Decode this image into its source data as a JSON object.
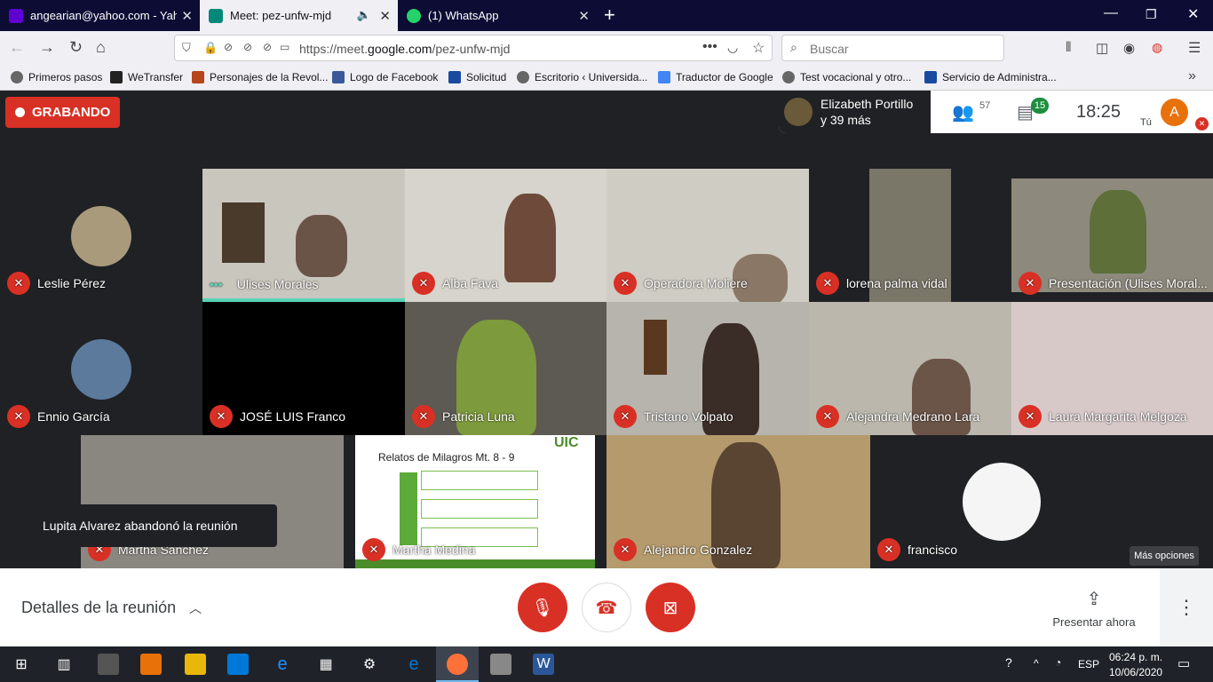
{
  "browser": {
    "tabs": [
      {
        "label": "angearian@yahoo.com - Yahoo",
        "color": "#6001d2"
      },
      {
        "label": "Meet: pez-unfw-mjd",
        "color": "#00897b"
      },
      {
        "label": "(1) WhatsApp",
        "color": "#25d366"
      }
    ],
    "url_prefix": "https://meet.",
    "url_domain": "google.com",
    "url_path": "/pez-unfw-mjd",
    "search_placeholder": "Buscar"
  },
  "bookmarks": [
    {
      "label": "Primeros pasos",
      "color": "#666"
    },
    {
      "label": "WeTransfer",
      "color": "#222"
    },
    {
      "label": "Personajes de la Revol...",
      "color": "#b5451b"
    },
    {
      "label": "Logo de Facebook",
      "color": "#3b5998"
    },
    {
      "label": "Solicitud",
      "color": "#1a4a9e"
    },
    {
      "label": "Escritorio ‹ Universida...",
      "color": "#666"
    },
    {
      "label": "Traductor de Google",
      "color": "#4285f4"
    },
    {
      "label": "Test vocacional y otro...",
      "color": "#666"
    },
    {
      "label": "Servicio de Administra...",
      "color": "#1a4a9e"
    }
  ],
  "meet": {
    "recording_label": "GRABANDO",
    "presenter_line1": "Elizabeth Portillo",
    "presenter_line2": "y 39 más",
    "participants_count": "57",
    "chat_count": "15",
    "clock": "18:25",
    "self_label": "Tú",
    "self_initial": "A",
    "participants": [
      {
        "name": "Leslie Pérez",
        "bg": "#202124",
        "avatar": "#a99a7c"
      },
      {
        "name": "Ulises Morales",
        "bg": "#c9c6bd"
      },
      {
        "name": "Alba Fava",
        "bg": "#d7d4cd"
      },
      {
        "name": "Operadora Moliere",
        "bg": "#cfccc3"
      },
      {
        "name": "lorena palma vidal",
        "bg": "#7a7668"
      },
      {
        "name": "Presentación  (Ulises Moral...",
        "bg": "#8d8a7d"
      },
      {
        "name": "Ennio García",
        "bg": "#202124",
        "avatar": "#5b7a9c"
      },
      {
        "name": "JOSÉ LUIS Franco",
        "bg": "#000000"
      },
      {
        "name": "Patricia Luna",
        "bg": "#5c5a52"
      },
      {
        "name": "Tristano Volpato",
        "bg": "#b6b4ad"
      },
      {
        "name": "Alejandra Medrano Lara",
        "bg": "#bbb7ad"
      },
      {
        "name": "Laura Margarita Melgoza",
        "bg": "#d8c9c9"
      },
      {
        "name": "Martha Sanchez",
        "bg": "#8a8680"
      },
      {
        "name": "Martha Medina",
        "bg": "#ffffff"
      },
      {
        "name": "Alejandro Gonzalez",
        "bg": "#b49a6c"
      },
      {
        "name": "francisco",
        "bg": "#202124",
        "avatar": "#f5f5f5"
      }
    ],
    "slide_title": "Relatos de Milagros Mt. 8 - 9",
    "slide_logo": "UIC",
    "toast": "Lupita Alvarez abandonó la reunión",
    "tooltip": "Más opciones"
  },
  "bottom": {
    "details": "Detalles de la reunión",
    "present": "Presentar ahora"
  },
  "taskbar": {
    "lang": "ESP",
    "time": "06:24 p. m.",
    "date": "10/06/2020"
  }
}
